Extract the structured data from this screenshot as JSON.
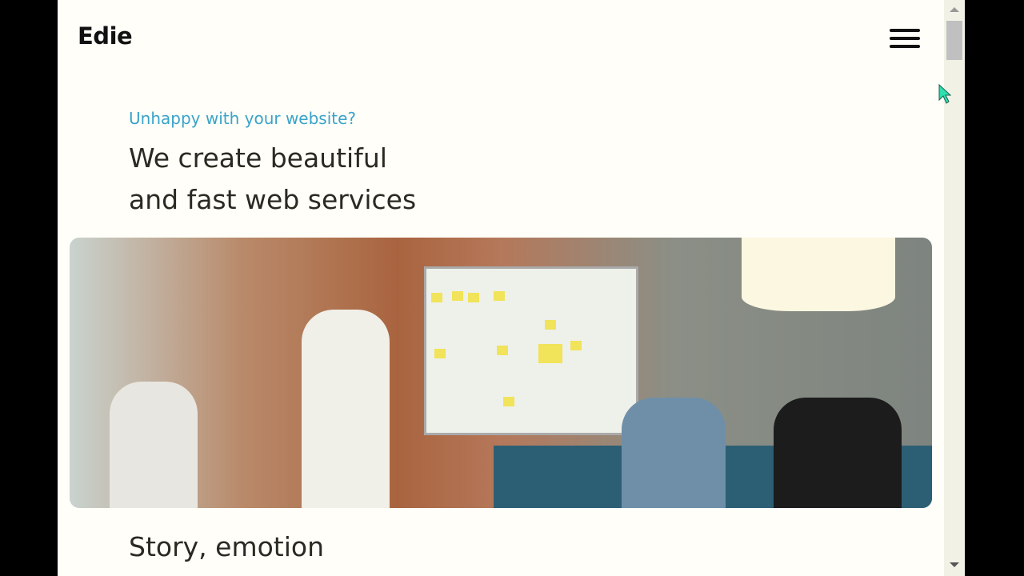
{
  "header": {
    "logo": "Edie",
    "menu_icon": "hamburger-icon"
  },
  "hero": {
    "eyebrow": "Unhappy with your website?",
    "headline_line1": "We create beautiful",
    "headline_line2": "and fast web services",
    "image_alt": "Team meeting in front of a whiteboard"
  },
  "next_section": {
    "heading": "Story, emotion"
  },
  "colors": {
    "accent": "#3aa3c9",
    "text": "#2a2a22",
    "background": "#fffef8"
  }
}
